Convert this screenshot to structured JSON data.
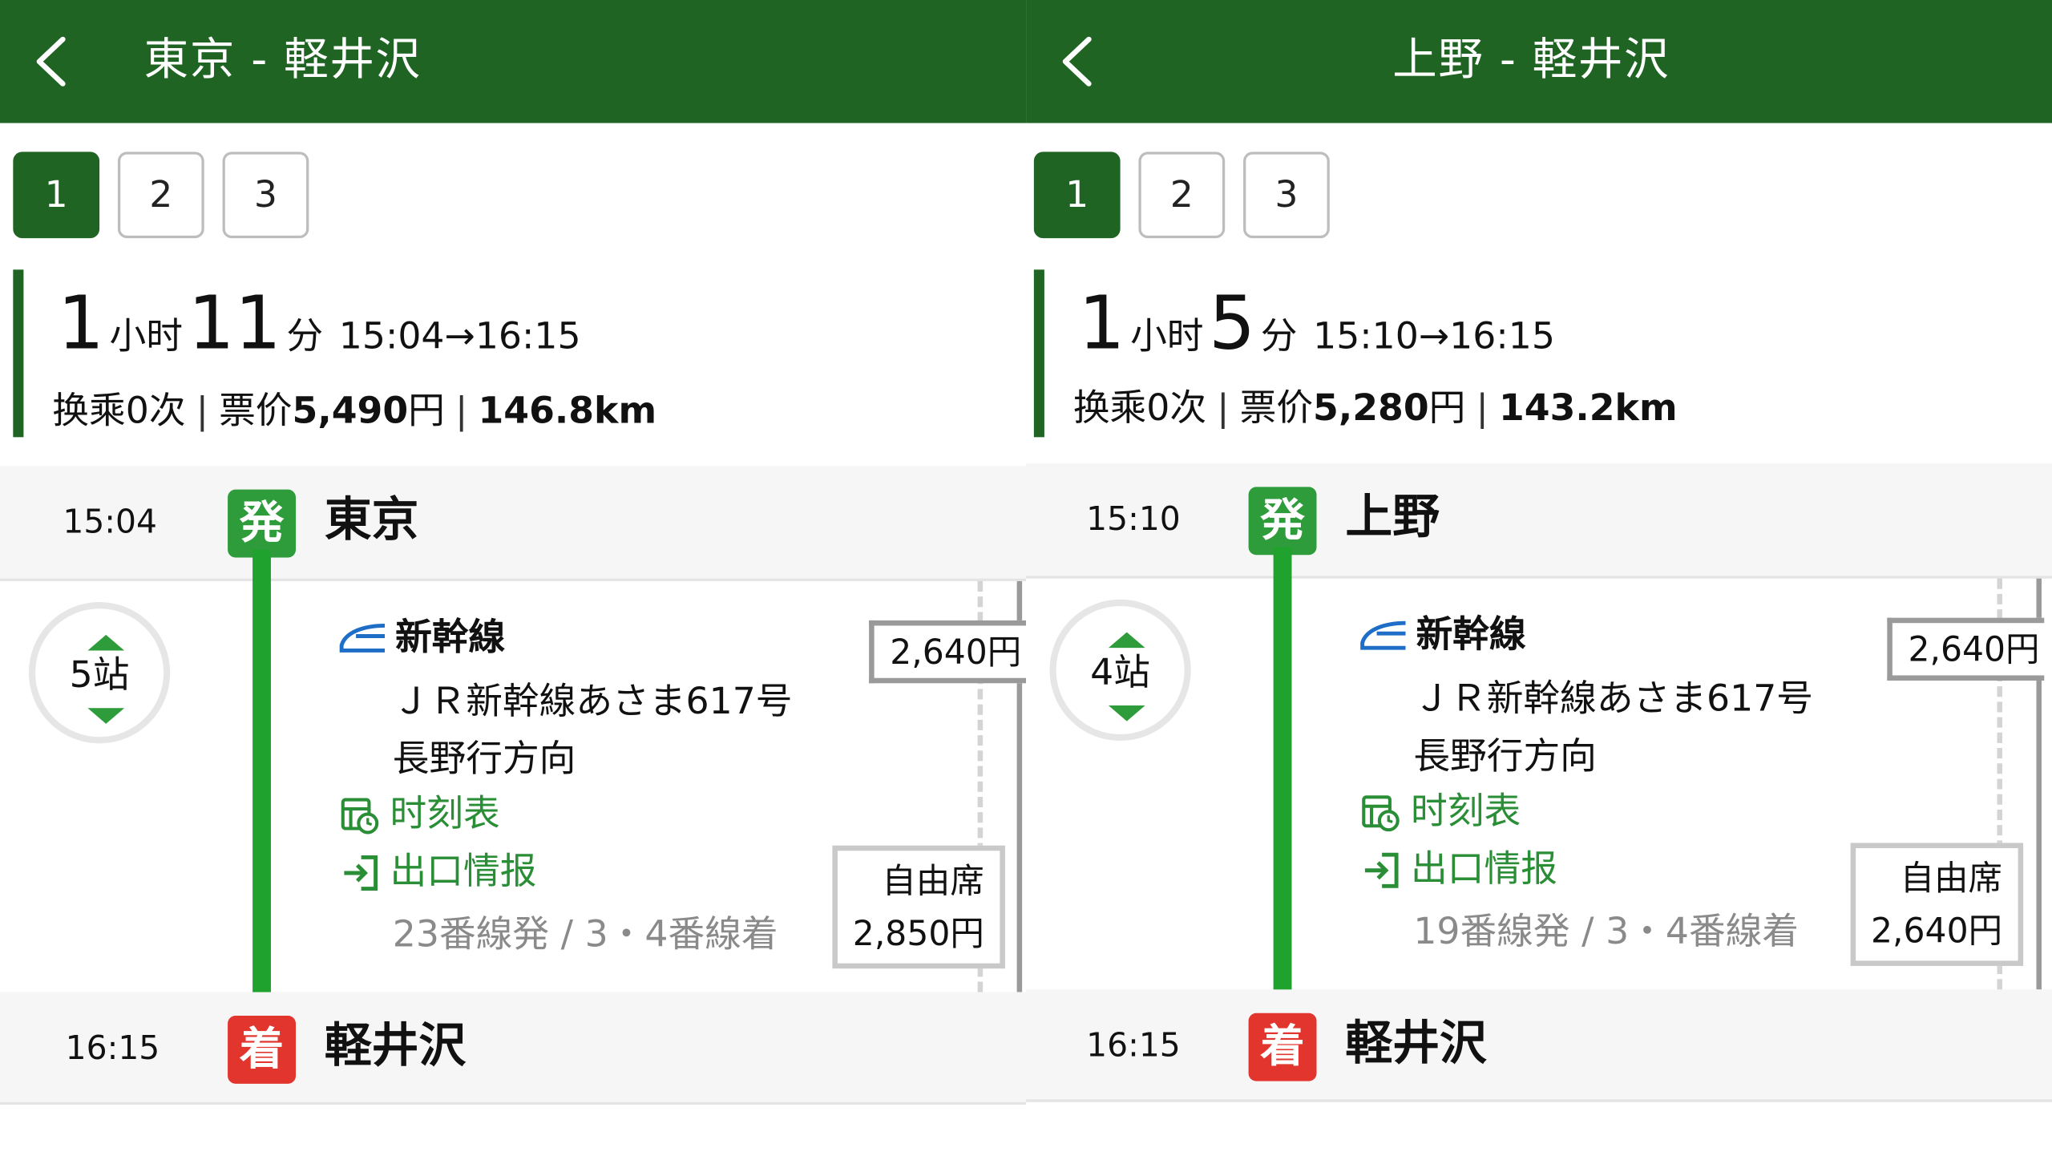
{
  "panels": [
    {
      "title": "東京 - 軽井沢",
      "tabs": [
        "1",
        "2",
        "3"
      ],
      "active_tab": "1",
      "duration_hours": "1",
      "hours_unit": "小时",
      "duration_minutes": "11",
      "minutes_unit": "分",
      "times": "15:04→16:15",
      "transfers": "换乘0次",
      "fare_label": "票价",
      "fare_value": "5,490",
      "fare_unit": "円",
      "distance": "146.8km",
      "departure": {
        "time": "15:04",
        "badge": "発",
        "station": "東京"
      },
      "arrival": {
        "time": "16:15",
        "badge": "着",
        "station": "軽井沢"
      },
      "stops": "5站",
      "line_name": "新幹線",
      "train": "ＪＲ新幹線あさま617号",
      "direction": "長野行方向",
      "timetable_link": "时刻表",
      "exit_link": "出口情报",
      "platform": "23番線発 / 3・4番線着",
      "fare_box": "2,640円",
      "seat_label": "自由席",
      "seat_price": "2,850円"
    },
    {
      "title": "上野 - 軽井沢",
      "tabs": [
        "1",
        "2",
        "3"
      ],
      "active_tab": "1",
      "duration_hours": "1",
      "hours_unit": "小时",
      "duration_minutes": "5",
      "minutes_unit": "分",
      "times": "15:10→16:15",
      "transfers": "换乘0次",
      "fare_label": "票价",
      "fare_value": "5,280",
      "fare_unit": "円",
      "distance": "143.2km",
      "departure": {
        "time": "15:10",
        "badge": "発",
        "station": "上野"
      },
      "arrival": {
        "time": "16:15",
        "badge": "着",
        "station": "軽井沢"
      },
      "stops": "4站",
      "line_name": "新幹線",
      "train": "ＪＲ新幹線あさま617号",
      "direction": "長野行方向",
      "timetable_link": "时刻表",
      "exit_link": "出口情报",
      "platform": "19番線発 / 3・4番線着",
      "fare_box": "2,640円",
      "seat_label": "自由席",
      "seat_price": "2,640円"
    }
  ],
  "colors": {
    "header_green": "#1f6423",
    "line_green": "#20a22e",
    "depart_badge": "#2e9c3a",
    "arrive_badge": "#e2352d",
    "link_green": "#2a8e36"
  },
  "icons": [
    "back-chevron-icon",
    "shinkansen-icon",
    "timetable-icon",
    "exit-icon",
    "stops-up-arrow-icon",
    "stops-down-arrow-icon"
  ]
}
